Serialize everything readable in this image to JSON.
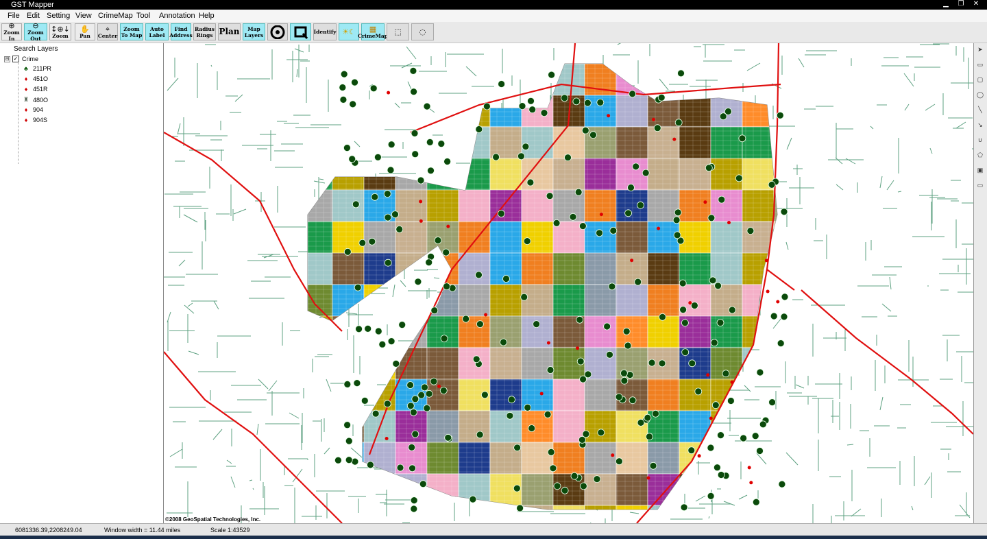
{
  "window": {
    "title": "GST Mapper",
    "buttons": [
      "▁",
      "❐",
      "✕"
    ]
  },
  "menu": [
    "File",
    "Edit",
    "Setting",
    "View",
    "CrimeMap",
    "Tool",
    "Annotation",
    "Help"
  ],
  "toolbar": {
    "zoom_in": "Zoom In",
    "zoom_out": "Zoom Out",
    "zoom": "Zoom",
    "pan": "Pan",
    "center": "Center",
    "zoom_to_map": "Zoom To Map",
    "auto_label": "Auto Label",
    "find_address": "Find Address",
    "radius_rings": "Radius Rings",
    "plan": "Plan",
    "map_layers": "Map Layers",
    "identify": "Identify",
    "crimemap": "CrimeMap"
  },
  "sidebar": {
    "header": "Search Layers",
    "root": {
      "label": "Crime",
      "expander": "⊟",
      "check": "✓"
    },
    "items": [
      {
        "label": "211PR",
        "icon": "green-figure-icon",
        "color": "#0a5a0a"
      },
      {
        "label": "451O",
        "icon": "red-pin-icon",
        "color": "#d00000"
      },
      {
        "label": "451R",
        "icon": "red-pin-icon",
        "color": "#d00000"
      },
      {
        "label": "480O",
        "icon": "gray-figure-icon",
        "color": "#556655"
      },
      {
        "label": "904",
        "icon": "red-pin-icon",
        "color": "#d00000"
      },
      {
        "label": "904S",
        "icon": "red-pin-icon",
        "color": "#d00000"
      }
    ]
  },
  "map": {
    "copyright": "©2008 GeoSpatial Technologies, Inc.",
    "colors": {
      "streets": "#3f8f6a",
      "highways": "#e01010",
      "marker": "#0b4a0b",
      "inner_streets": "#888888"
    },
    "district_palette": [
      "#1e3c8c",
      "#7b5a3a",
      "#e88ccf",
      "#2aa8e8",
      "#f0d000",
      "#9a2e9a",
      "#b8a000",
      "#5a3b12",
      "#8a9aa8",
      "#c4ad8a",
      "#f07f20",
      "#1a9a4a",
      "#a8a8a8",
      "#b0b0d0",
      "#e8c8a0",
      "#9aa070",
      "#c8b090",
      "#a0c8c8",
      "#ff8c2a",
      "#f4b0c8",
      "#6e8a30",
      "#f0e060"
    ]
  },
  "status": {
    "coordinates": "6081336.39,2208249.04",
    "window_width": "Window width = 11.44 miles",
    "scale": "Scale 1:43529"
  }
}
